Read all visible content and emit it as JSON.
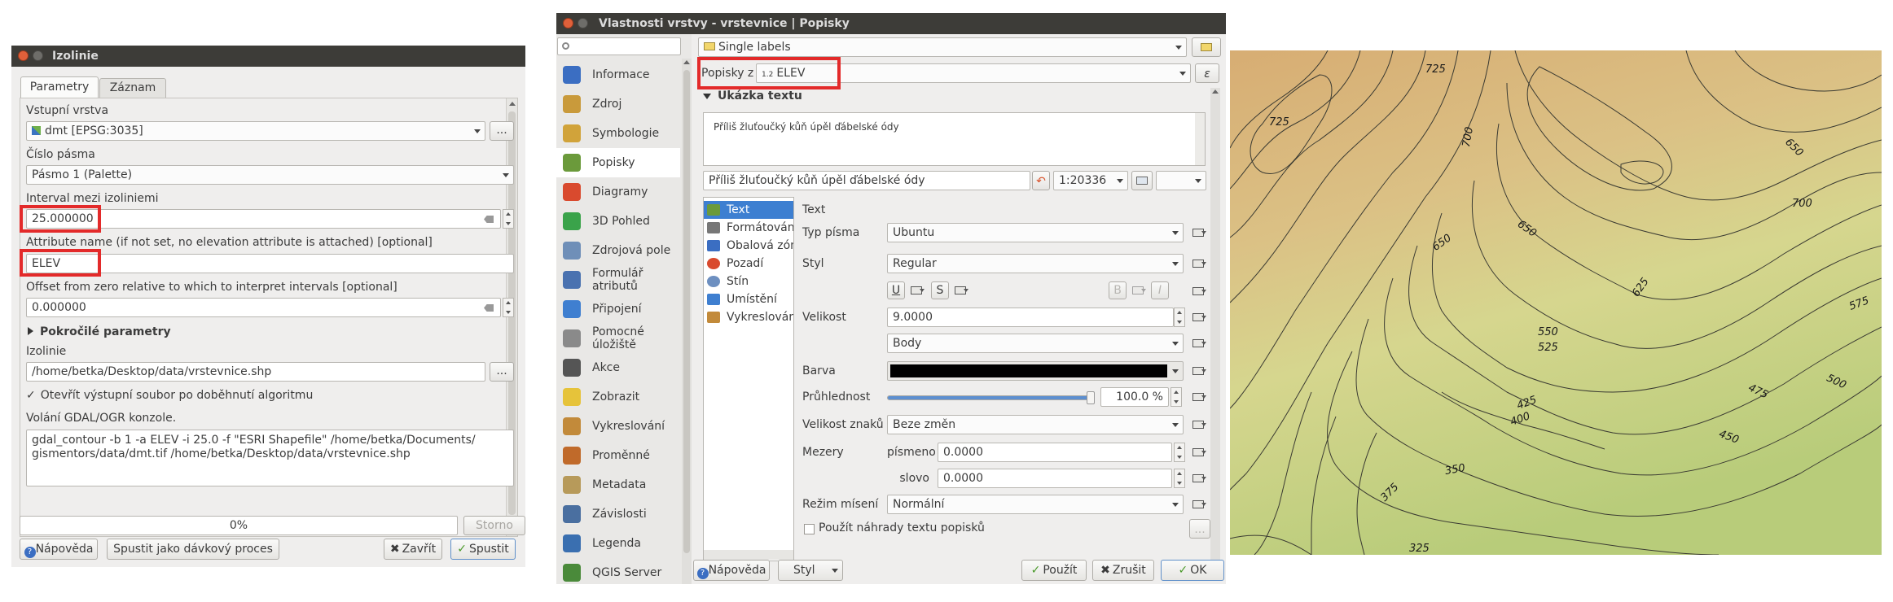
{
  "izolinie": {
    "title": "Izolinie",
    "tabs": [
      "Parametry",
      "Záznam"
    ],
    "input_layer_label": "Vstupní vrstva",
    "input_layer_value": "dmt [EPSG:3035]",
    "band_label": "Číslo pásma",
    "band_value": "Pásmo 1 (Palette)",
    "interval_label": "Interval mezi izoliniemi",
    "interval_value": "25.000000",
    "attr_label": "Attribute name (if not set, no elevation attribute is attached) [optional]",
    "attr_value": "ELEV",
    "offset_label": "Offset from zero relative to which to interpret intervals [optional]",
    "offset_value": "0.000000",
    "advanced_label": "Pokročilé parametry",
    "output_label": "Izolinie",
    "output_value": "/home/betka/Desktop/data/vrstevnice.shp",
    "browse_label": "...",
    "open_after_label": "Otevřít výstupní soubor po doběhnutí algoritmu",
    "console_label": "Volání GDAL/OGR konzole.",
    "console_text": "gdal_contour -b 1 -a ELEV -i 25.0 -f \"ESRI Shapefile\" /home/betka/Documents/\ngismentors/data/dmt.tif /home/betka/Desktop/data/vrstevnice.shp",
    "progress_text": "0%",
    "progress": 0,
    "cancel_label": "Storno",
    "help_label": "Nápověda",
    "batch_label": "Spustit jako dávkový proces",
    "close_label": "Zavřít",
    "run_label": "Spustit"
  },
  "props": {
    "title": "Vlastnosti vrstvy - vrstevnice | Popisky",
    "search_placeholder": "",
    "sidebar": [
      {
        "label": "Informace",
        "icon": "info-icon",
        "color": "#3b6ec2"
      },
      {
        "label": "Zdroj",
        "icon": "source-icon",
        "color": "#c99a3b"
      },
      {
        "label": "Symbologie",
        "icon": "symbology-icon",
        "color": "#d1a33a"
      },
      {
        "label": "Popisky",
        "icon": "labels-icon",
        "color": "#6b9a3b"
      },
      {
        "label": "Diagramy",
        "icon": "diagram-icon",
        "color": "#d94a2e"
      },
      {
        "label": "3D Pohled",
        "icon": "cube-icon",
        "color": "#3aa34a"
      },
      {
        "label": "Zdrojová pole",
        "icon": "fields-icon",
        "color": "#6f8fb8"
      },
      {
        "label": "Formulář atributů",
        "icon": "form-icon",
        "color": "#4a72b0"
      },
      {
        "label": "Připojení",
        "icon": "join-icon",
        "color": "#3f7fd0"
      },
      {
        "label": "Pomocné úložiště",
        "icon": "storage-icon",
        "color": "#8a8a8a"
      },
      {
        "label": "Akce",
        "icon": "action-icon",
        "color": "#555555"
      },
      {
        "label": "Zobrazit",
        "icon": "display-icon",
        "color": "#e6c33a"
      },
      {
        "label": "Vykreslování",
        "icon": "brush-icon",
        "color": "#c28a3a"
      },
      {
        "label": "Proměnné",
        "icon": "variable-icon",
        "color": "#c06a2a"
      },
      {
        "label": "Metadata",
        "icon": "metadata-icon",
        "color": "#b79a5a"
      },
      {
        "label": "Závislosti",
        "icon": "dependency-icon",
        "color": "#4a6fa0"
      },
      {
        "label": "Legenda",
        "icon": "legend-icon",
        "color": "#3a6fb0"
      },
      {
        "label": "QGIS Server",
        "icon": "server-icon",
        "color": "#4a8a3a"
      }
    ],
    "mode_value": "Single labels",
    "label_with": "Popisky z",
    "field_type": "1.2",
    "field_value": "ELEV",
    "sample_header": "Ukázka textu",
    "sample_text": "Příliš žluťoučký kůň úpěl ďábelské ódy",
    "scale_value": "1:20336",
    "tabs": [
      "Text",
      "Formátování",
      "Obalová zóna",
      "Pozadí",
      "Stín",
      "Umístění",
      "Vykreslování"
    ],
    "section_title": "Text",
    "font_label": "Typ písma",
    "font_value": "Ubuntu",
    "style_label": "Styl",
    "style_value": "Regular",
    "u_label": "U",
    "s_label": "S",
    "b_label": "B",
    "i_label": "I",
    "size_label": "Velikost",
    "size_value": "9.0000",
    "unit_value": "Body",
    "color_label": "Barva",
    "color_value": "#000000",
    "opacity_label": "Průhlednost",
    "opacity_value": "100.0 %",
    "opacity": 1.0,
    "case_label": "Velikost znaků",
    "case_value": "Beze změn",
    "spacing_label": "Mezery",
    "letter_label": "písmeno",
    "letter_value": "0.0000",
    "word_label": "slovo",
    "word_value": "0.0000",
    "blend_label": "Režim mísení",
    "blend_value": "Normální",
    "substitute_label": "Použít náhrady textu popisků",
    "help_label": "Nápověda",
    "style_btn": "Styl",
    "apply_label": "Použít",
    "cancel_label": "Zrušit",
    "ok_label": "OK"
  },
  "map": {
    "contour_labels": [
      "725",
      "725",
      "700",
      "650",
      "700",
      "650",
      "650",
      "625",
      "575",
      "550",
      "525",
      "475",
      "500",
      "425",
      "400",
      "450",
      "375",
      "350",
      "325"
    ]
  }
}
